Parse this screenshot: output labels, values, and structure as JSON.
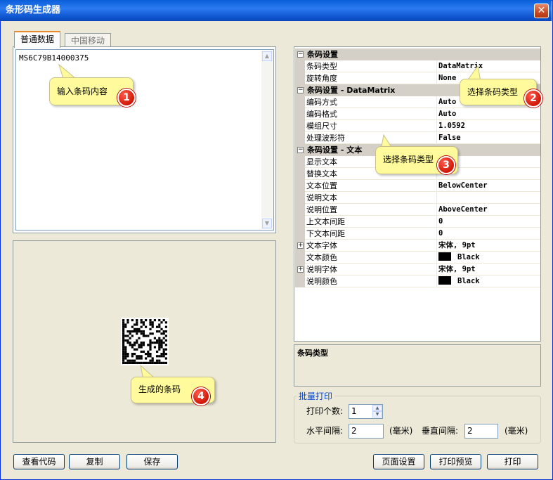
{
  "window": {
    "title": "条形码生成器",
    "close_label": "✕"
  },
  "tabs": [
    {
      "label": "普通数据",
      "active": true
    },
    {
      "label": "中国移动",
      "active": false
    }
  ],
  "content_input": {
    "value": "MS6C79B14000375"
  },
  "property_grid": {
    "rows": [
      {
        "kind": "category",
        "name": "条码设置",
        "expander": "⊟"
      },
      {
        "kind": "item",
        "name": "条码类型",
        "value": "DataMatrix"
      },
      {
        "kind": "item",
        "name": "旋转角度",
        "value": "None"
      },
      {
        "kind": "category",
        "name": "条码设置 - DataMatrix",
        "expander": "⊟"
      },
      {
        "kind": "item",
        "name": "编码方式",
        "value": "Auto"
      },
      {
        "kind": "item",
        "name": "编码格式",
        "value": "Auto"
      },
      {
        "kind": "item",
        "name": "模组尺寸",
        "value": "1.0592"
      },
      {
        "kind": "item",
        "name": "处理波形符",
        "value": "False"
      },
      {
        "kind": "category",
        "name": "条码设置 - 文本",
        "expander": "⊟"
      },
      {
        "kind": "item",
        "name": "显示文本",
        "value": ""
      },
      {
        "kind": "item",
        "name": "替换文本",
        "value": ""
      },
      {
        "kind": "item",
        "name": "文本位置",
        "value": "BelowCenter"
      },
      {
        "kind": "item",
        "name": "说明文本",
        "value": ""
      },
      {
        "kind": "item",
        "name": "说明位置",
        "value": "AboveCenter"
      },
      {
        "kind": "item",
        "name": "上文本间距",
        "value": "0"
      },
      {
        "kind": "item",
        "name": "下文本间距",
        "value": "0"
      },
      {
        "kind": "item",
        "name": "文本字体",
        "value": "宋体, 9pt",
        "expander": "⊞"
      },
      {
        "kind": "item",
        "name": "文本颜色",
        "value": "Black",
        "swatch": "#000000"
      },
      {
        "kind": "item",
        "name": "说明字体",
        "value": "宋体, 9pt",
        "expander": "⊞"
      },
      {
        "kind": "item",
        "name": "说明颜色",
        "value": "Black",
        "swatch": "#000000"
      }
    ]
  },
  "help": {
    "title": "条码类型"
  },
  "batch_print": {
    "legend": "批量打印",
    "count_label": "打印个数:",
    "count_value": "1",
    "h_spacing_label": "水平间隔:",
    "h_spacing_value": "2",
    "h_unit": "(毫米)",
    "v_spacing_label": "垂直间隔:",
    "v_spacing_value": "2",
    "v_unit": "(毫米)"
  },
  "buttons": {
    "view_code": "查看代码",
    "copy": "复制",
    "save": "保存",
    "page_setup": "页面设置",
    "print_preview": "打印预览",
    "print": "打印"
  },
  "callouts": [
    {
      "text": "输入条码内容",
      "number": "1"
    },
    {
      "text": "选择条码类型",
      "number": "2"
    },
    {
      "text": "选择条码类型",
      "number": "3"
    },
    {
      "text": "生成的条码",
      "number": "4"
    }
  ],
  "colors": {
    "titlebar": "#0a5fd8",
    "callout": "#fffa9b",
    "badge": "#d01808",
    "group_legend": "#0046d5"
  }
}
